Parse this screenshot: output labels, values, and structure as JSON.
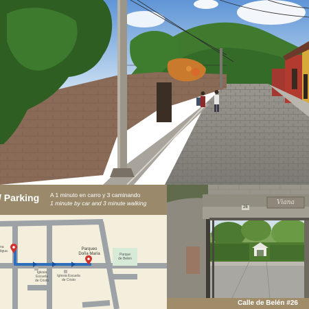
{
  "map_panel": {
    "title": "/ Parking",
    "walking_note_es": "A 1 minuto en carro y 3 caminando",
    "walking_note_en": "1 minute by car and 3 minute walking",
    "parking_name_line1": "Parqueo",
    "parking_name_line2": "Doña María",
    "start_label_line1": "na",
    "start_label_line2": "tigua",
    "park_label_line1": "Parque",
    "park_label_line2": "de Belén",
    "school_label_line1": "Iglesia",
    "school_label_line2": "Escuela",
    "school_label_line3": "de Cristo",
    "church_label_line1": "Iglesia Escuela",
    "church_label_line2": "de Cristo",
    "route_color": "#2e6fbd",
    "marker_color": "#d0312d"
  },
  "entrance_photo": {
    "house_number": "26",
    "sign_text": "Viana"
  },
  "caption": {
    "text": "Calle de Belén #26"
  }
}
